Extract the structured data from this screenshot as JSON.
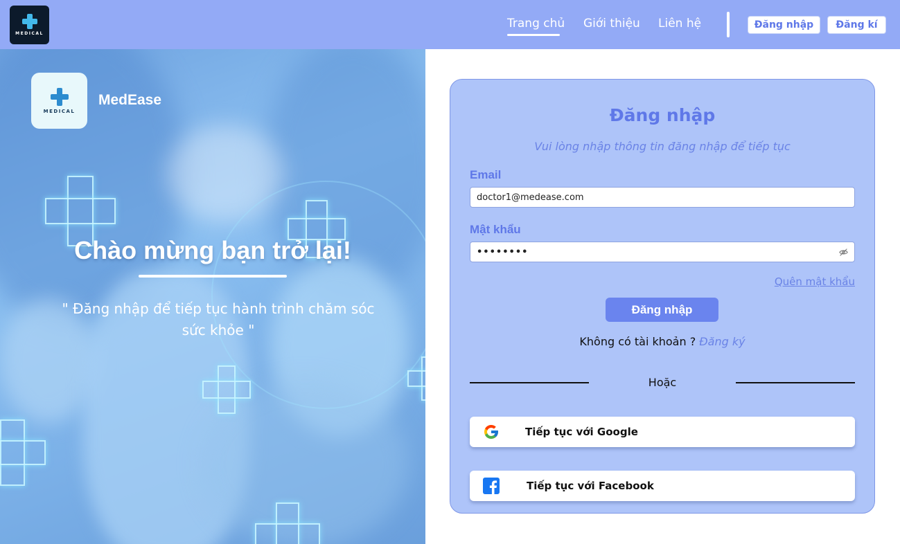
{
  "header": {
    "logo_text": "MEDICAL",
    "nav": [
      {
        "label": "Trang chủ",
        "active": true
      },
      {
        "label": "Giới thiệu"
      },
      {
        "label": "Liên hệ"
      }
    ],
    "login_label": "Đăng nhập",
    "register_label": "Đăng kí"
  },
  "hero": {
    "logo_text": "MEDICAL",
    "brand_name": "MedEase",
    "welcome": "Chào mừng bạn trở lại!",
    "quote": "\" Đăng nhập để tiếp tục hành trình chăm sóc sức khỏe \""
  },
  "login": {
    "title": "Đăng nhập",
    "subtitle": "Vui lòng nhập thông tin đăng nhập để tiếp tục",
    "email_label": "Email",
    "email_value": "doctor1@medease.com",
    "password_label": "Mật khẩu",
    "password_value": "••••••••",
    "forgot_label": "Quên mật khẩu",
    "submit_label": "Đăng nhập",
    "no_account_text": "Không có tài khoản ? ",
    "register_link": "Đăng ký",
    "or_text": "Hoặc",
    "google_label": "Tiếp tục với Google",
    "facebook_label": "Tiếp tục với Facebook"
  },
  "colors": {
    "header_bg": "#93aaf6",
    "card_bg": "#aec4f9",
    "accent": "#5f78e8",
    "button": "#6a84ee"
  }
}
